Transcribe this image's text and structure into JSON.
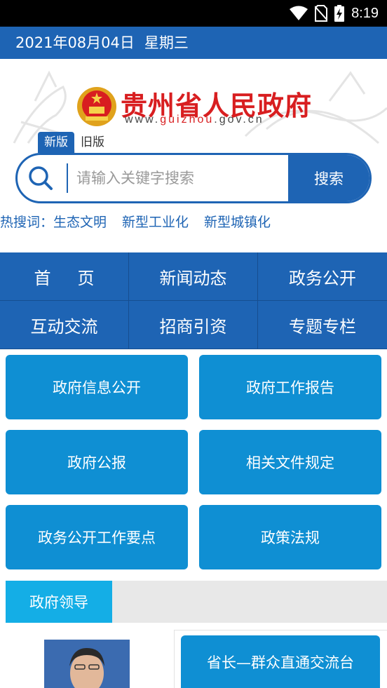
{
  "status_bar": {
    "time": "8:19"
  },
  "date_bar": {
    "date": "2021年08月04日",
    "weekday": "星期三"
  },
  "header": {
    "title": "贵州省人民政府",
    "url_prefix": "www.",
    "url_highlight": "guizhou",
    "url_suffix": ".gov.cn",
    "tab_new": "新版",
    "tab_old": "旧版"
  },
  "search": {
    "placeholder": "请输入关键字搜索",
    "button_label": "搜索"
  },
  "hot_search": {
    "label": "热搜词：",
    "keywords": [
      "生态文明",
      "新型工业化",
      "新型城镇化"
    ]
  },
  "nav": {
    "items": [
      "首页",
      "新闻动态",
      "政务公开",
      "互动交流",
      "招商引资",
      "专题专栏"
    ]
  },
  "tiles": [
    "政府信息公开",
    "政府工作报告",
    "政府公报",
    "相关文件规定",
    "政务公开工作要点",
    "政策法规"
  ],
  "leaders": {
    "tab_label": "政府领导",
    "governor_button": "省长—群众直通交流台"
  },
  "colors": {
    "primary": "#1e64b4",
    "tile": "#0f8fd3",
    "tab_active": "#14aee6",
    "title_red": "#d81e20"
  }
}
